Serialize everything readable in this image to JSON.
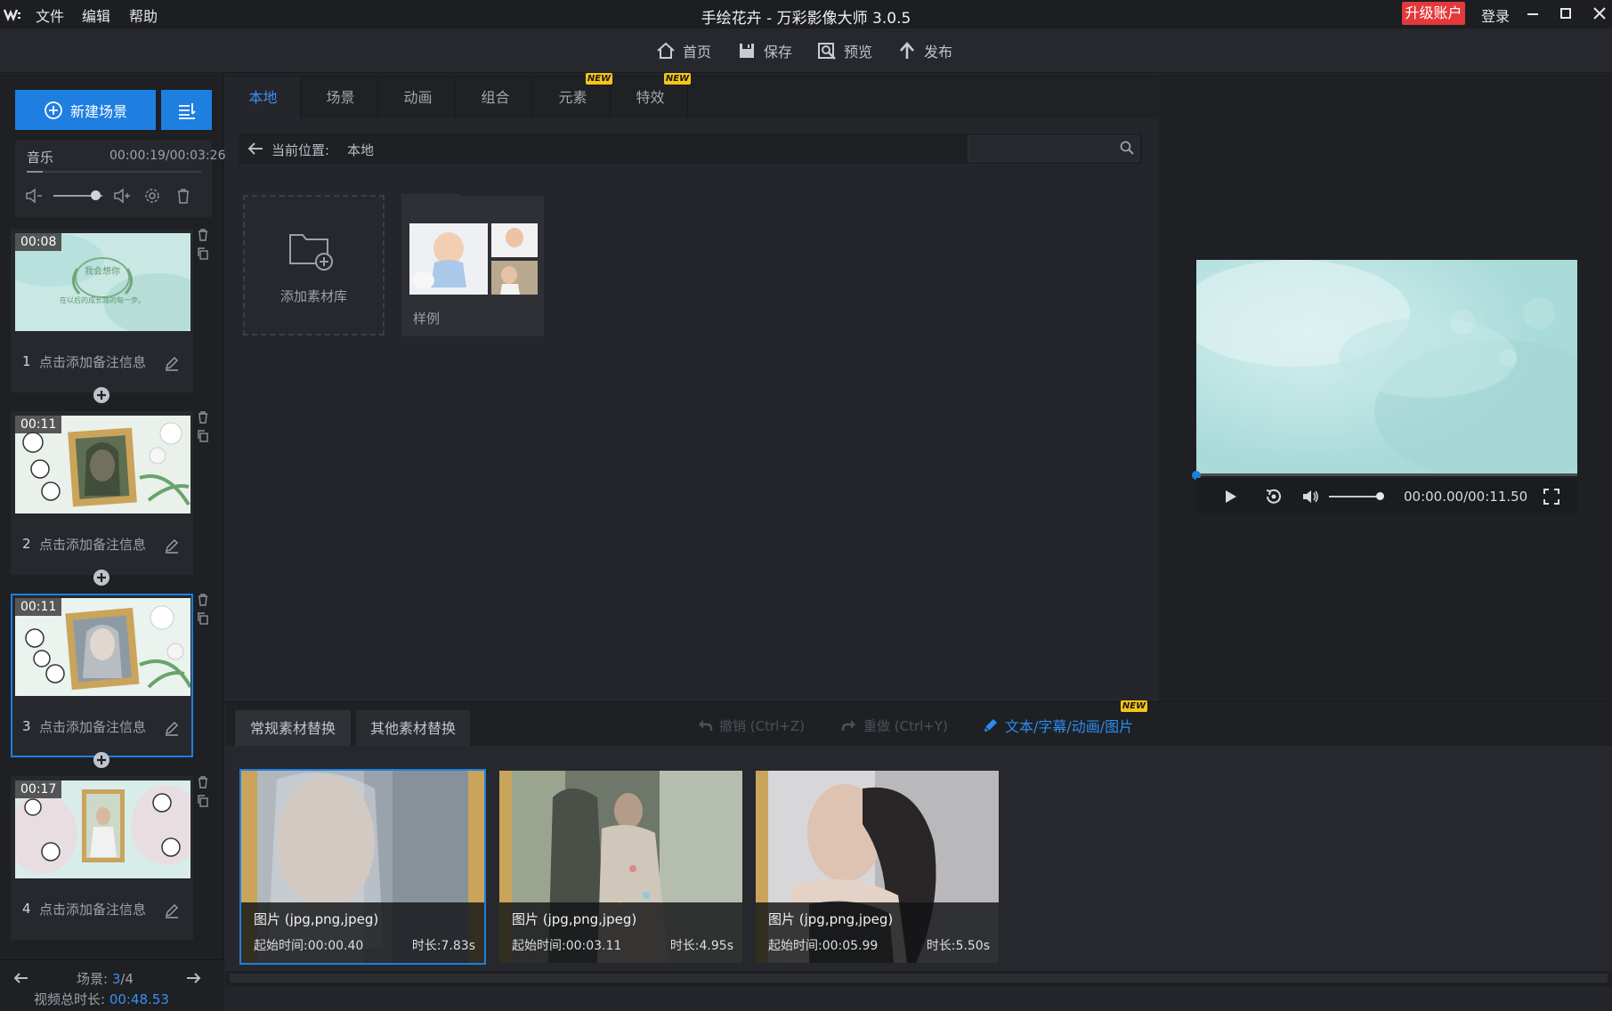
{
  "titlebar": {
    "logo": "W",
    "menu": [
      "文件",
      "编辑",
      "帮助"
    ],
    "title": "手绘花卉 - 万彩影像大师 3.0.5",
    "upgrade": "升级账户",
    "login": "登录"
  },
  "toolbar": {
    "home": "首页",
    "save": "保存",
    "preview": "预览",
    "publish": "发布"
  },
  "left": {
    "new_scene": "新建场景",
    "music_label": "音乐",
    "music_time": "00:00:19/00:03:26",
    "music_progress": 0.09,
    "music_volume": 0.85,
    "scenes": [
      {
        "num": "1",
        "time": "00:08",
        "note": "点击添加备注信息",
        "selected": false
      },
      {
        "num": "2",
        "time": "00:11",
        "note": "点击添加备注信息",
        "selected": false
      },
      {
        "num": "3",
        "time": "00:11",
        "note": "点击添加备注信息",
        "selected": true
      },
      {
        "num": "4",
        "time": "00:17",
        "note": "点击添加备注信息",
        "selected": false
      }
    ],
    "scene1_art_title": "我会想你",
    "scene1_art_sub": "在以后的成长路的每一步。",
    "scene_counter_label": "场景: ",
    "scene_current": "3",
    "scene_total": "/4",
    "total_duration_label": "视频总时长: ",
    "total_duration": "00:48.53"
  },
  "library": {
    "tabs": [
      "本地",
      "场景",
      "动画",
      "组合",
      "元素",
      "特效"
    ],
    "active_tab": 0,
    "new_badge": "NEW",
    "path_label": "当前位置:",
    "path_value": "本地",
    "search_value": "",
    "add_library": "添加素材库",
    "sample_folder": "样例"
  },
  "preview": {
    "time": "00:00.00/00:11.50",
    "progress": 0,
    "volume": 0.95
  },
  "bottom": {
    "tabs": [
      "常规素材替换",
      "其他素材替换"
    ],
    "undo": "撤销 (Ctrl+Z)",
    "redo": "重做 (Ctrl+Y)",
    "text_link": "文本/字幕/动画/图片",
    "new_badge": "NEW",
    "items": [
      {
        "title": "图片 (jpg,png,jpeg)",
        "start": "起始时间:00:00.40",
        "duration": "时长:7.83s",
        "selected": true
      },
      {
        "title": "图片 (jpg,png,jpeg)",
        "start": "起始时间:00:03.11",
        "duration": "时长:4.95s",
        "selected": false
      },
      {
        "title": "图片 (jpg,png,jpeg)",
        "start": "起始时间:00:05.99",
        "duration": "时长:5.50s",
        "selected": false
      }
    ]
  },
  "colors": {
    "accent": "#1e7fe0",
    "upgrade": "#e3393b",
    "link": "#2b8cf0",
    "badge": "#f5c518"
  }
}
